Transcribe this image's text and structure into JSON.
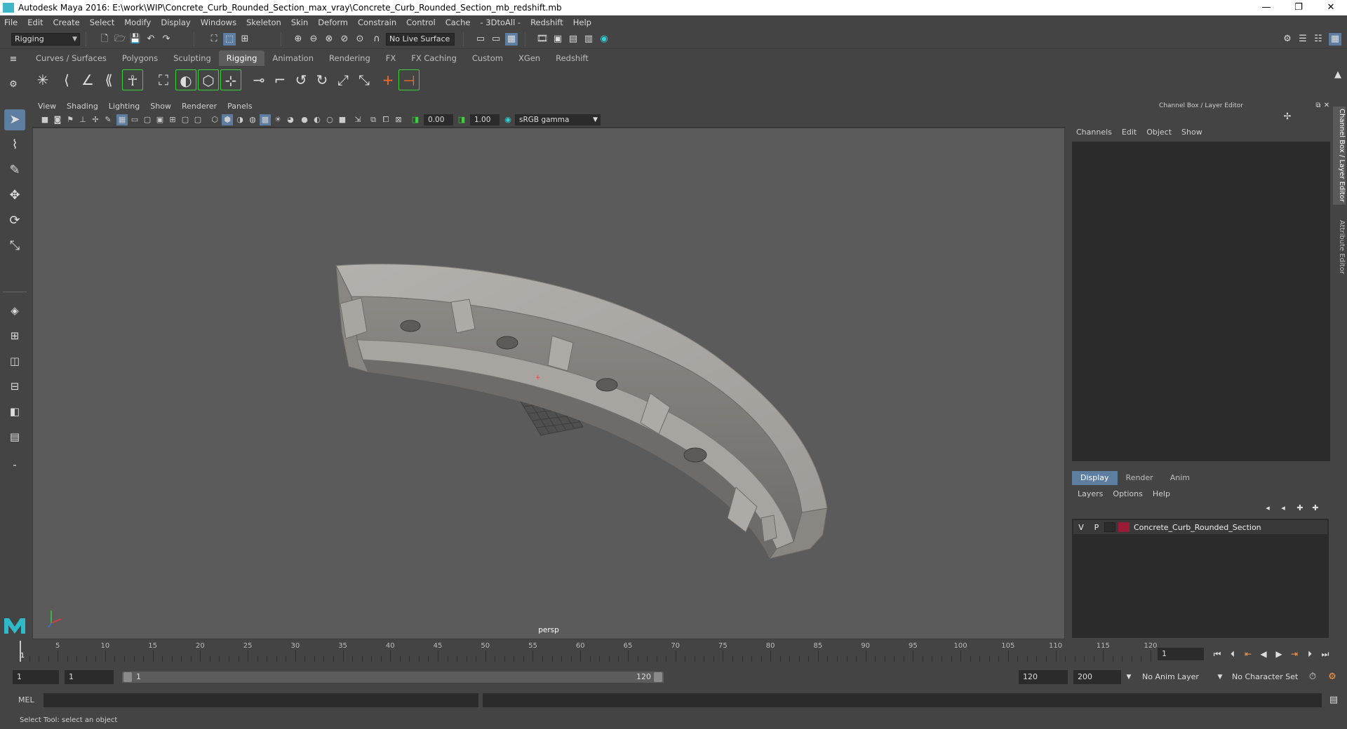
{
  "window": {
    "title": "Autodesk Maya 2016: E:\\work\\WIP\\Concrete_Curb_Rounded_Section_max_vray\\Concrete_Curb_Rounded_Section_mb_redshift.mb",
    "minimize": "—",
    "restore": "❐",
    "close": "✕"
  },
  "menubar": [
    "File",
    "Edit",
    "Create",
    "Select",
    "Modify",
    "Display",
    "Windows",
    "Skeleton",
    "Skin",
    "Deform",
    "Constrain",
    "Control",
    "Cache",
    "- 3DtoAll -",
    "Redshift",
    "Help"
  ],
  "statusline": {
    "menuset": "Rigging",
    "live_surface": "No Live Surface"
  },
  "shelf": {
    "tabs": [
      "Curves / Surfaces",
      "Polygons",
      "Sculpting",
      "Rigging",
      "Animation",
      "Rendering",
      "FX",
      "FX Caching",
      "Custom",
      "XGen",
      "Redshift"
    ],
    "active_tab": "Rigging"
  },
  "viewport": {
    "menu": [
      "View",
      "Shading",
      "Lighting",
      "Show",
      "Renderer",
      "Panels"
    ],
    "exposure": "0.00",
    "gamma": "1.00",
    "color_space": "sRGB gamma",
    "camera_label": "persp"
  },
  "channel_box": {
    "title": "Channel Box / Layer Editor",
    "menu": [
      "Channels",
      "Edit",
      "Object",
      "Show"
    ]
  },
  "layer_editor": {
    "tabs": [
      "Display",
      "Render",
      "Anim"
    ],
    "active_tab": "Display",
    "menu": [
      "Layers",
      "Options",
      "Help"
    ],
    "layers": [
      {
        "v": "V",
        "p": "P",
        "name": "Concrete_Curb_Rounded_Section",
        "color": "#9a1b35"
      }
    ]
  },
  "side_tabs": [
    "Channel Box / Layer Editor",
    "Attribute Editor"
  ],
  "timeline": {
    "start_label": "1",
    "ticks": [
      5,
      10,
      15,
      20,
      25,
      30,
      35,
      40,
      45,
      50,
      55,
      60,
      65,
      70,
      75,
      80,
      85,
      90,
      95,
      100,
      105,
      110,
      115,
      120
    ],
    "min": 1,
    "max": 120,
    "current_frame": "1"
  },
  "range": {
    "start": "1",
    "playback_start": "1",
    "slider_start": "1",
    "slider_end": "120",
    "playback_end": "120",
    "end": "200",
    "anim_layer": "No Anim Layer",
    "character_set": "No Character Set"
  },
  "command_line": {
    "label": "MEL"
  },
  "help_line": "Select Tool: select an object"
}
